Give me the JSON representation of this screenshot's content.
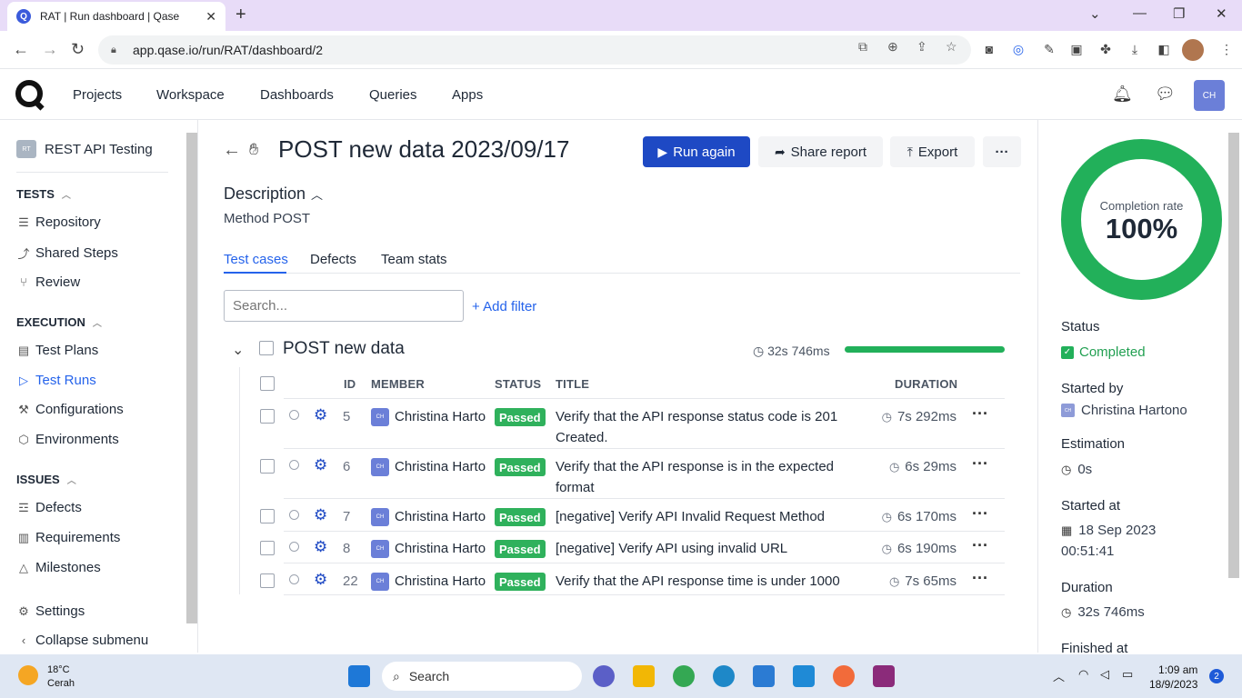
{
  "browser": {
    "tab_title": "RAT | Run dashboard | Qase",
    "favicon_letter": "Q",
    "url": "app.qase.io/run/RAT/dashboard/2"
  },
  "header": {
    "nav": [
      "Projects",
      "Workspace",
      "Dashboards",
      "Queries",
      "Apps"
    ],
    "avatar": "CH"
  },
  "sidebar": {
    "project_badge": "RT",
    "project_name": "REST API Testing",
    "sections": {
      "tests": "TESTS",
      "execution": "EXECUTION",
      "issues": "ISSUES"
    },
    "items": {
      "repository": "Repository",
      "shared_steps": "Shared Steps",
      "review": "Review",
      "test_plans": "Test Plans",
      "test_runs": "Test Runs",
      "configurations": "Configurations",
      "environments": "Environments",
      "defects": "Defects",
      "requirements": "Requirements",
      "milestones": "Milestones",
      "settings": "Settings",
      "collapse": "Collapse submenu"
    }
  },
  "main": {
    "title": "POST new data 2023/09/17",
    "buttons": {
      "run_again": "Run again",
      "share": "Share report",
      "export": "Export",
      "more": "···"
    },
    "description_title": "Description",
    "description": "Method POST",
    "tabs": [
      "Test cases",
      "Defects",
      "Team stats"
    ],
    "search_placeholder": "Search...",
    "add_filter": "+ Add filter",
    "suite": {
      "title": "POST new data",
      "time": "32s 746ms",
      "progress": 1.0
    },
    "columns": [
      "ID",
      "MEMBER",
      "STATUS",
      "TITLE",
      "DURATION"
    ],
    "rows": [
      {
        "id": "5",
        "avatar": "CH",
        "member": "Christina Hartono",
        "status": "Passed",
        "title": "Verify that the API response status code is 201 Created.",
        "duration": "7s 292ms"
      },
      {
        "id": "6",
        "avatar": "CH",
        "member": "Christina Hartono",
        "status": "Passed",
        "title": "Verify that the API response is in the expected format",
        "duration": "6s 29ms"
      },
      {
        "id": "7",
        "avatar": "CH",
        "member": "Christina Hartono",
        "status": "Passed",
        "title": "[negative] Verify API Invalid Request Method",
        "duration": "6s 170ms"
      },
      {
        "id": "8",
        "avatar": "CH",
        "member": "Christina Hartono",
        "status": "Passed",
        "title": "[negative] Verify API using invalid URL",
        "duration": "6s 190ms"
      },
      {
        "id": "22",
        "avatar": "CH",
        "member": "Christina Hartono",
        "status": "Passed",
        "title": "Verify that the API response time is under 1000",
        "duration": "7s 65ms"
      }
    ]
  },
  "panel": {
    "completion_label": "Completion rate",
    "completion_value": "100%",
    "status_label": "Status",
    "status_value": "Completed",
    "started_by_label": "Started by",
    "started_by_avatar": "CH",
    "started_by_value": "Christina Hartono",
    "estimation_label": "Estimation",
    "estimation_value": "0s",
    "started_at_label": "Started at",
    "started_at_date": "18 Sep 2023",
    "started_at_time": "00:51:41",
    "duration_label": "Duration",
    "duration_value": "32s 746ms",
    "finished_at_label": "Finished at"
  },
  "taskbar": {
    "temp": "18°C",
    "weather": "Cerah",
    "search": "Search",
    "time": "1:09 am",
    "date": "18/9/2023",
    "notifications": "2"
  },
  "colors": {
    "accent": "#1e49c4",
    "link": "#2563eb",
    "passed": "#2fb15c",
    "tab_strip": "#e8dcf8"
  }
}
